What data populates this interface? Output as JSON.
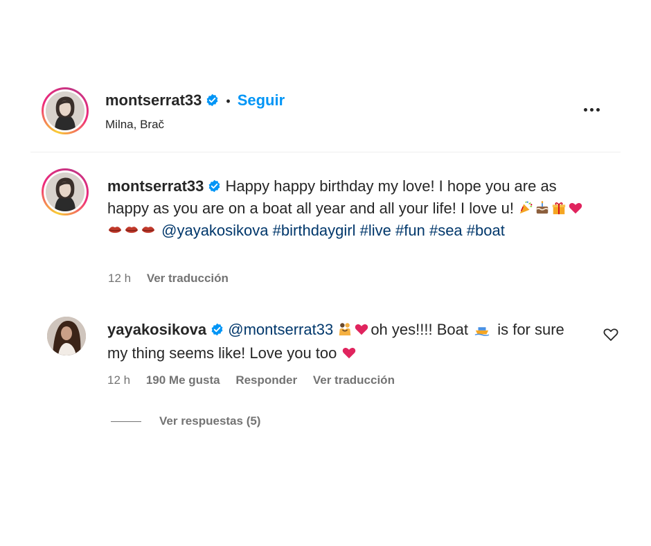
{
  "post": {
    "username": "montserrat33",
    "separator": "•",
    "follow_label": "Seguir",
    "location": "Milna, Brač"
  },
  "caption": {
    "username": "montserrat33",
    "text": "Happy happy birthday my love! I hope you are as happy as you are on a boat all year and all your life! I love u!",
    "emojis": [
      "party-popper",
      "cake",
      "gift",
      "red-heart",
      "lips",
      "lips",
      "lips"
    ],
    "mention": "@yayakosikova",
    "hashtags": [
      "#birthdaygirl",
      "#live",
      "#fun",
      "#sea",
      "#boat"
    ],
    "time": "12 h",
    "translate_label": "Ver traducción"
  },
  "comment": {
    "username": "yayakosikova",
    "mention": "@montserrat33",
    "text_part1": "oh yes!!!! Boat",
    "text_part2": "is for sure my thing seems like! Love you too",
    "time": "12 h",
    "likes_label": "190 Me gusta",
    "reply_label": "Responder",
    "translate_label": "Ver traducción"
  },
  "replies": {
    "label": "Ver respuestas (5)"
  },
  "colors": {
    "link": "#00376b",
    "follow": "#0095f6",
    "secondary": "#737373",
    "verified": "#0095f6",
    "heart": "#e0245e"
  }
}
